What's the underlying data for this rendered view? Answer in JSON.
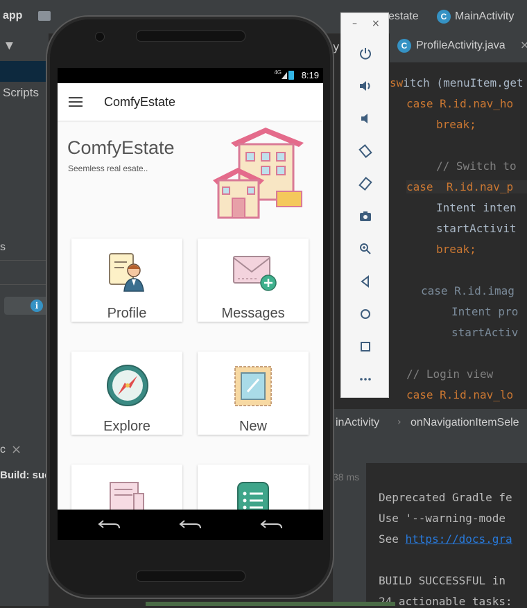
{
  "ide": {
    "breadcrumb_app": "app",
    "breadcrumb_estate": "estate",
    "breadcrumb_main": "MainActivity",
    "left_scripts": "Scripts",
    "left_s": "s",
    "left_c": "c",
    "left_build": "Build: suc",
    "tab_label": "ProfileActivity.java",
    "tab_y": "y",
    "nav_left": "inActivity",
    "nav_right": "onNavigationItemSele",
    "ms": "38 ms",
    "code_lines": [
      "itch (menuItem.get",
      "case R.id.nav_ho",
      "break;",
      "// Switch to",
      "case  R.id.nav_p",
      "Intent inten",
      "startActivit",
      "break;",
      "case R.id.imag",
      "Intent pro",
      "startActiv",
      "// Login view",
      "case R.id.nav_lo"
    ],
    "console": {
      "line1": "Deprecated Gradle fe",
      "line2": "Use '--warning-mode ",
      "line3_prefix": "See ",
      "line3_link": "https://docs.gra",
      "line4": "BUILD SUCCESSFUL in ",
      "line5": "24 actionable tasks:"
    }
  },
  "emulator": {
    "minimize": "–",
    "close": "×"
  },
  "phone": {
    "status_time": "8:19",
    "status_network": "4G",
    "app_title": "ComfyEstate",
    "hero_title": "ComfyEstate",
    "hero_subtitle": "Seemless real esate..",
    "cards": [
      {
        "label": "Profile"
      },
      {
        "label": "Messages"
      },
      {
        "label": "Explore"
      },
      {
        "label": "New"
      },
      {
        "label": ""
      },
      {
        "label": ""
      }
    ]
  },
  "colors": {
    "ide_bg": "#2b2b2b",
    "keyword": "#cc7832",
    "field": "#9876aa",
    "accent_blue": "#3592c4"
  }
}
